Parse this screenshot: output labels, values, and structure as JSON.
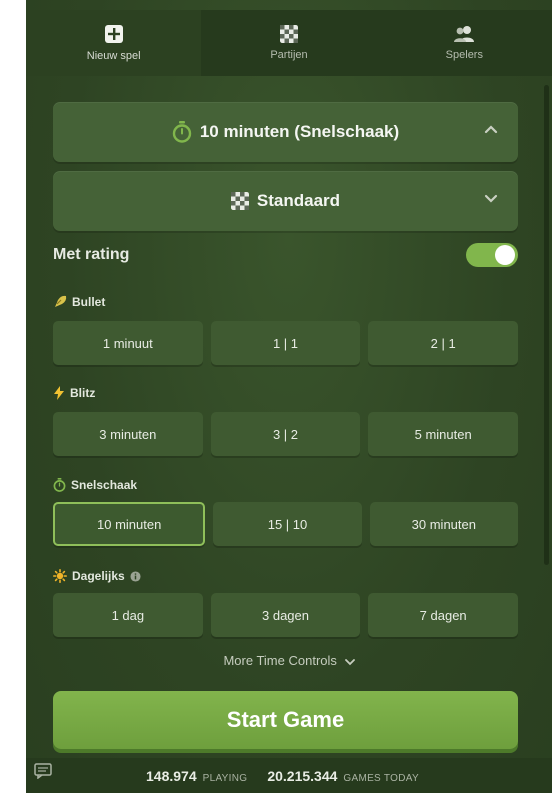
{
  "tabs": [
    {
      "label": "Nieuw spel",
      "icon": "plus-square-icon",
      "active": true
    },
    {
      "label": "Partijen",
      "icon": "chessboard-icon",
      "active": false
    },
    {
      "label": "Spelers",
      "icon": "users-icon",
      "active": false
    }
  ],
  "time_dropdown": {
    "label": "10 minuten (Snelschaak)",
    "icon": "stopwatch-icon"
  },
  "variant_dropdown": {
    "label": "Standaard",
    "icon": "chessboard-icon"
  },
  "rated": {
    "label": "Met rating",
    "enabled": true
  },
  "sections": {
    "bullet": {
      "title": "Bullet",
      "options": [
        "1 minuut",
        "1 | 1",
        "2 | 1"
      ]
    },
    "blitz": {
      "title": "Blitz",
      "options": [
        "3 minuten",
        "3 | 2",
        "5 minuten"
      ]
    },
    "rapid": {
      "title": "Snelschaak",
      "options": [
        "10 minuten",
        "15 | 10",
        "30 minuten"
      ],
      "selected": "10 minuten"
    },
    "daily": {
      "title": "Dagelijks",
      "options": [
        "1 dag",
        "3 dagen",
        "7 dagen"
      ]
    }
  },
  "more_time_controls": "More Time Controls",
  "start_button": "Start Game",
  "footer": {
    "playing_count": "148.974",
    "playing_label": "PLAYING",
    "games_count": "20.215.344",
    "games_label": "GAMES TODAY"
  },
  "colors": {
    "accent_green": "#81b64c",
    "panel_bg": "#2f4524",
    "selected_border": "#8fbf5a"
  }
}
